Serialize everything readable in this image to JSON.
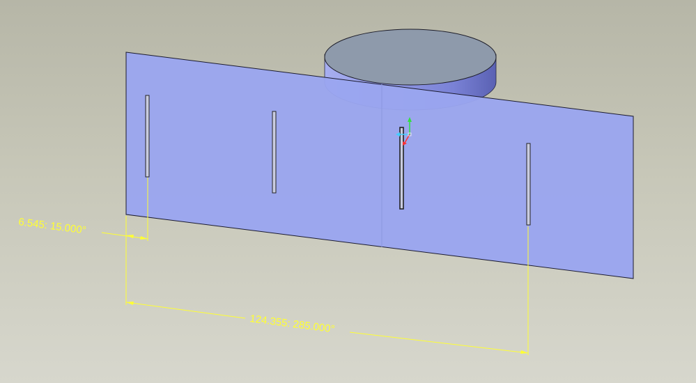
{
  "viewport": {
    "background_top": "#b6b6a7",
    "background_bottom": "#d7d7cd"
  },
  "model": {
    "plate_color": "#9aa6ef",
    "plate_edge_color": "#1a1a2e",
    "cylinder_top_color": "#8e9aab",
    "cylinder_side_color": "#6d74c8",
    "slot_fill_color": "#c9cce0",
    "slot_count": 4
  },
  "csys": {
    "x_axis_color": "#ff3030",
    "y_axis_color": "#30e040",
    "z_axis_color": "#40d0ff"
  },
  "dimensions": {
    "color": "#ffff33",
    "small": {
      "label": "6.545: 15.000°"
    },
    "large": {
      "label": "124.355: 285.000°"
    }
  }
}
